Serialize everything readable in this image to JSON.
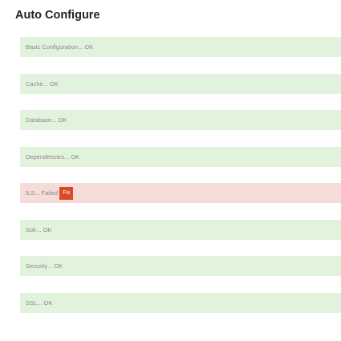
{
  "page": {
    "title": "Auto Configure"
  },
  "checks": [
    {
      "label": "Basic Configuration",
      "status": "OK",
      "state": "ok"
    },
    {
      "label": "Cache",
      "status": "OK",
      "state": "ok"
    },
    {
      "label": "Database",
      "status": "OK",
      "state": "ok"
    },
    {
      "label": "Dependencies",
      "status": "OK",
      "state": "ok"
    },
    {
      "label": "ILS",
      "status": "Failed",
      "state": "failed",
      "action_label": "Fix"
    },
    {
      "label": "Solr",
      "status": "OK",
      "state": "ok"
    },
    {
      "label": "Security",
      "status": "OK",
      "state": "ok"
    },
    {
      "label": "SSL",
      "status": "OK",
      "state": "ok"
    }
  ],
  "separator": "...",
  "colors": {
    "ok_background": "#e2f3dd",
    "failed_background": "#f5dcd9",
    "fix_button": "#d84a25",
    "text_muted": "#888888",
    "title_text": "#222222"
  }
}
